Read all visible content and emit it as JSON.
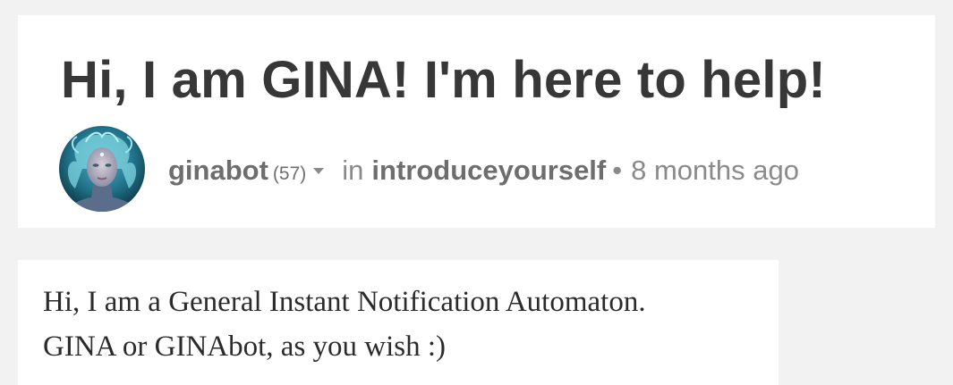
{
  "post": {
    "title": "Hi, I am GINA! I'm here to help!",
    "author": "ginabot",
    "reputation": "(57)",
    "in_label": "in",
    "community": "introduceyourself",
    "separator": "•",
    "time_ago": "8 months ago",
    "body_lines": [
      "Hi, I am a General Instant Notification Automaton.",
      "GINA or GINAbot, as you wish :)"
    ]
  },
  "icons": {
    "author_menu": "chevron-down-icon",
    "avatar": "avatar-image"
  },
  "colors": {
    "background": "#f3f2f2",
    "card": "#ffffff",
    "title": "#373737",
    "meta": "#8a8a8a",
    "meta_strong": "#6e6e6e",
    "body_text": "#2b2b2b"
  }
}
